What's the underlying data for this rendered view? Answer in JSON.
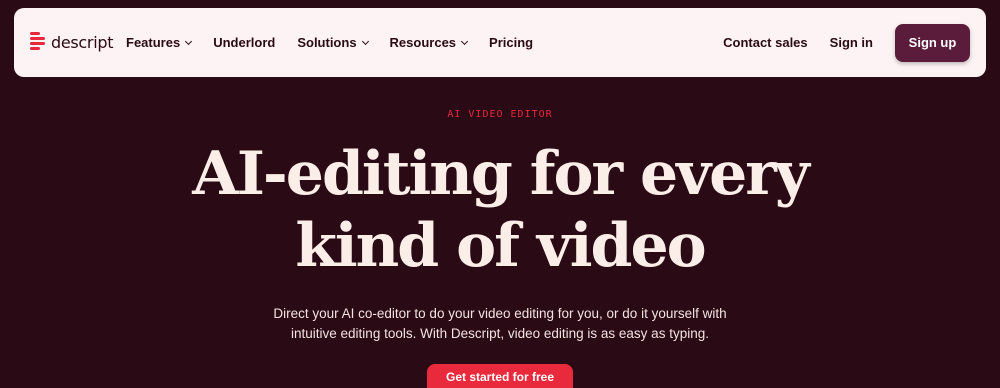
{
  "brand": {
    "name": "descript",
    "accent": "#e8283b"
  },
  "nav": {
    "menu": [
      {
        "label": "Features",
        "dropdown": true
      },
      {
        "label": "Underlord",
        "dropdown": false
      },
      {
        "label": "Solutions",
        "dropdown": true
      },
      {
        "label": "Resources",
        "dropdown": true
      },
      {
        "label": "Pricing",
        "dropdown": false
      }
    ],
    "contact_sales": "Contact sales",
    "sign_in": "Sign in",
    "sign_up": "Sign up"
  },
  "hero": {
    "eyebrow": "AI VIDEO EDITOR",
    "headline_line1": "AI-editing for every",
    "headline_line2": "kind of video",
    "sub_line1": "Direct your AI co-editor to do your video editing for you, or do it yourself with",
    "sub_line2": "intuitive editing tools. With Descript, video editing is as easy as typing.",
    "cta": "Get started for free"
  },
  "colors": {
    "background": "#2a0a15",
    "nav_background": "#fdf3f4",
    "signup_button": "#5b1b3b",
    "cta_button": "#e82a3c"
  }
}
